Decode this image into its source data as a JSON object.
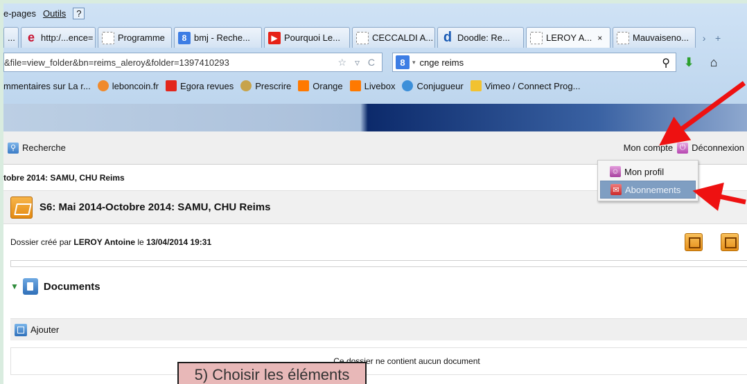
{
  "menubar": {
    "item1": "e-pages",
    "item2": "Outils",
    "item3": "?"
  },
  "tabs": [
    {
      "label": "...",
      "icon": "blank-page-icon"
    },
    {
      "label": "http:/...ence=",
      "icon": "ie-logo-icon"
    },
    {
      "label": "Programme",
      "icon": "blank-page-icon"
    },
    {
      "label": "bmj - Reche...",
      "icon": "google-icon"
    },
    {
      "label": "Pourquoi Le...",
      "icon": "youtube-icon"
    },
    {
      "label": "CECCALDI A...",
      "icon": "blank-page-icon"
    },
    {
      "label": "Doodle: Re...",
      "icon": "doodle-icon"
    },
    {
      "label": "LEROY A...",
      "icon": "blank-page-icon",
      "close": "×"
    },
    {
      "label": "Mauvaiseno...",
      "icon": "blank-page-icon"
    }
  ],
  "address": {
    "url": "&file=view_folder&bn=reims_aleroy&folder=1397410293",
    "icons": "☆ ▿ C"
  },
  "search": {
    "engine": "8",
    "query": "cnge reims"
  },
  "bookmarks": [
    {
      "label": "mmentaires sur La r...",
      "color": ""
    },
    {
      "label": "leboncoin.fr",
      "color": "#f08a2c"
    },
    {
      "label": "Egora revues",
      "color": "#e2261c"
    },
    {
      "label": "Prescrire",
      "color": "#c7a34a"
    },
    {
      "label": "Orange",
      "color": "#ff7900"
    },
    {
      "label": "Livebox",
      "color": "#ff7900"
    },
    {
      "label": "Conjugueur",
      "color": "#3c8fd9"
    },
    {
      "label": "Vimeo / Connect Prog...",
      "color": "#f2c230"
    }
  ],
  "toolbar": {
    "search_label": "Recherche",
    "account_label": "Mon compte",
    "logout_label": "Déconnexion"
  },
  "dropdown": {
    "profile_label": "Mon profil",
    "subscriptions_label": "Abonnements"
  },
  "crumb": "tobre 2014: SAMU, CHU Reims",
  "folder": {
    "title": "S6: Mai 2014-Octobre 2014: SAMU, CHU Reims",
    "meta_prefix": "Dossier créé par ",
    "author": "LEROY Antoine",
    "meta_mid": " le ",
    "date": "13/04/2014 19:31"
  },
  "documents": {
    "heading": "Documents",
    "add_label": "Ajouter",
    "empty": "Ce dossier ne contient aucun document"
  },
  "annotation": {
    "text": "5) Choisir les éléments"
  },
  "colors": {
    "arrow": "#ee1111",
    "accent": "#0c2a6b"
  }
}
